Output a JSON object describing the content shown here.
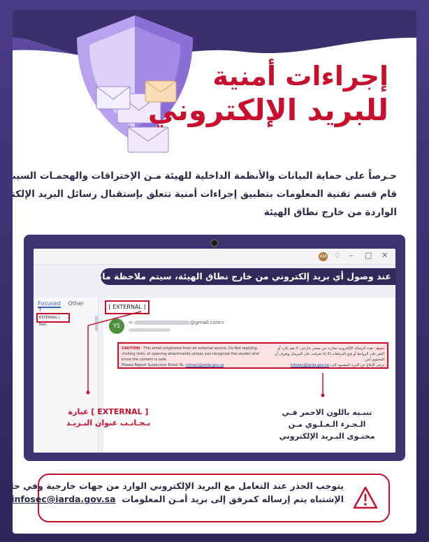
{
  "title": {
    "line1": "إجراءات أمنية",
    "line2": "للبريد الإلكتروني"
  },
  "intro": {
    "line1": "حـرصاً على حماية البيانات والأنظمة الداخلية للهيئة مـن الإختراقات والهجمـات السيبرانية",
    "line2": "قام قسم تقنية المعلومات بتطبيق إجراءات أمنية تتعلق بإستقبال رسائل البريد الإلكتروني",
    "line3": "الواردة من خارج نطاق الهيئة"
  },
  "screen": {
    "avatar_initials": "AM",
    "banner": "عند وصول أي بريد إلكتروني من خارج نطاق الهيئة، سيتم ملاحظة مايلي",
    "tabs": {
      "focused": "Focused",
      "other": "Other"
    },
    "mini_tag": "EXTERNAL | Red..",
    "subject_tag": "[ EXTERNAL ]",
    "sender_initials": "YS",
    "sender_domain": "@gmail.com>",
    "caution_en": {
      "label": "CAUTION",
      "text": " - This email originated from an external source. Do Not replying, clicking links, or opening attachments unless you recognize the sender and know the content is safe.",
      "report": "Please Report Suspicious Email To: ",
      "email": "infosec@iarda.gov.sa"
    },
    "caution_ar": {
      "label": "تنبيه",
      "text": " - هذه الرسالة الإلكترونية صادرة من مصدر خارجي، لا تقم بالرد أو النقر على الروابط أو فتح المرفقات إلا إذا تعرفت على المرسل وتعرف أن المحتوى آمن.",
      "report": "يرجى الإبلاغ عن البريد المشبوه إلى: ",
      "email": "infosec@iarda.gov.sa"
    }
  },
  "annotations": {
    "left": {
      "line1": "عبارة [ EXTERNAL ]",
      "line2": "بـجـانـب عنوان البـريـد"
    },
    "right": {
      "line1": "تنبـيه باللون الاحمر فـي",
      "line2": "الـجـزء الـعـلـوي مـن",
      "line3": "محتـوى البـريد الإلكتروني"
    }
  },
  "warning": {
    "line1": "يتوجب الحذر عند التعامل مع البريد الإلكتروني الوارد من جهات خارجية وفي حال",
    "line2": "الإشتباه يتم إرساله كمرفق إلى بريد أمـن المعلومات",
    "email": "infosec@iarda.gov.sa"
  },
  "colors": {
    "accent": "#c8102e",
    "navy": "#2f2a5a",
    "purple": "#3d3370"
  }
}
